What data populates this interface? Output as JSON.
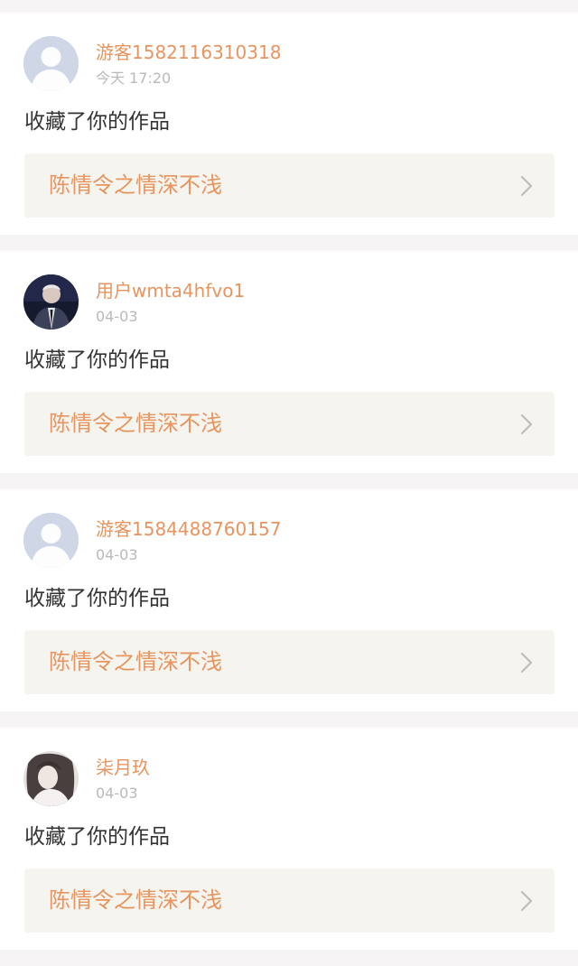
{
  "notifications": [
    {
      "username": "游客1582116310318",
      "time": "今天 17:20",
      "action": "收藏了你的作品",
      "work_title": "陈情令之情深不浅",
      "avatar": "default-avatar"
    },
    {
      "username": "用户wmta4hfvo1",
      "time": "04-03",
      "action": "收藏了你的作品",
      "work_title": "陈情令之情深不浅",
      "avatar": "photo-avatar-dark"
    },
    {
      "username": "游客1584488760157",
      "time": "04-03",
      "action": "收藏了你的作品",
      "work_title": "陈情令之情深不浅",
      "avatar": "default-avatar"
    },
    {
      "username": "柒月玖",
      "time": "04-03",
      "action": "收藏了你的作品",
      "work_title": "陈情令之情深不浅",
      "avatar": "photo-avatar-light"
    }
  ],
  "colors": {
    "accent": "#e8945f",
    "muted_text": "#b9b9b9",
    "body_text": "#333333",
    "card_bg": "#ffffff",
    "link_bg": "#f5f4ef",
    "page_bg": "#f6f4f4"
  }
}
